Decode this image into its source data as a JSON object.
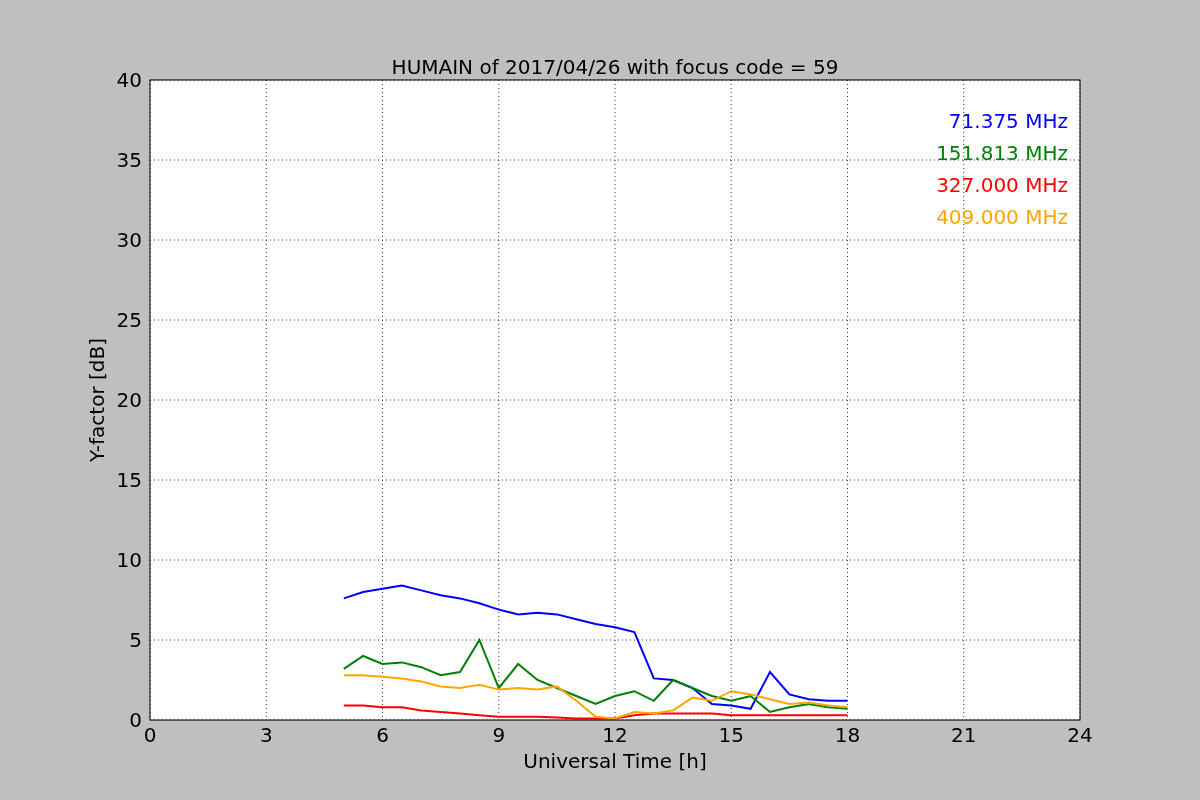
{
  "figure": {
    "chart_data": {
      "type": "line",
      "title": "HUMAIN of 2017/04/26 with focus code = 59",
      "xlabel": "Universal Time [h]",
      "ylabel": "Y-factor [dB]",
      "x": [
        5,
        5.5,
        6,
        6.5,
        7,
        7.5,
        8,
        8.5,
        9,
        9.5,
        10,
        10.5,
        11,
        11.5,
        12,
        12.5,
        13,
        13.5,
        14,
        14.5,
        15,
        15.5,
        16,
        16.5,
        17,
        17.5,
        18
      ],
      "series": [
        {
          "name": "71.375 MHz",
          "color": "#0000ff",
          "values": [
            7.6,
            8.0,
            8.2,
            8.4,
            8.1,
            7.8,
            7.6,
            7.3,
            6.9,
            6.6,
            6.7,
            6.6,
            6.3,
            6.0,
            5.8,
            5.5,
            2.6,
            2.5,
            2.0,
            1.0,
            0.9,
            0.7,
            3.0,
            1.6,
            1.3,
            1.2,
            1.2
          ]
        },
        {
          "name": "151.813 MHz",
          "color": "#008000",
          "values": [
            3.2,
            4.0,
            3.5,
            3.6,
            3.3,
            2.8,
            3.0,
            5.0,
            2.0,
            3.5,
            2.5,
            2.0,
            1.5,
            1.0,
            1.5,
            1.8,
            1.2,
            2.5,
            2.0,
            1.5,
            1.2,
            1.5,
            0.5,
            0.8,
            1.0,
            0.8,
            0.7
          ]
        },
        {
          "name": "327.000 MHz",
          "color": "#ff0000",
          "values": [
            0.9,
            0.9,
            0.8,
            0.8,
            0.6,
            0.5,
            0.4,
            0.3,
            0.2,
            0.2,
            0.2,
            0.15,
            0.1,
            0.1,
            0.1,
            0.3,
            0.4,
            0.4,
            0.4,
            0.4,
            0.3,
            0.3,
            0.3,
            0.3,
            0.3,
            0.3,
            0.3
          ]
        },
        {
          "name": "409.000 MHz",
          "color": "#ffa500",
          "values": [
            2.8,
            2.8,
            2.7,
            2.6,
            2.4,
            2.1,
            2.0,
            2.2,
            1.9,
            2.0,
            1.9,
            2.1,
            1.2,
            0.2,
            0.1,
            0.5,
            0.4,
            0.6,
            1.4,
            1.2,
            1.8,
            1.6,
            1.3,
            1.0,
            1.1,
            0.9,
            0.8
          ]
        }
      ],
      "xlim": [
        0,
        24
      ],
      "ylim": [
        0,
        40
      ],
      "grid": true,
      "xticks": [
        0,
        3,
        6,
        9,
        12,
        15,
        18,
        21,
        24
      ],
      "yticks": [
        0,
        5,
        10,
        15,
        20,
        25,
        30,
        35,
        40
      ]
    }
  }
}
